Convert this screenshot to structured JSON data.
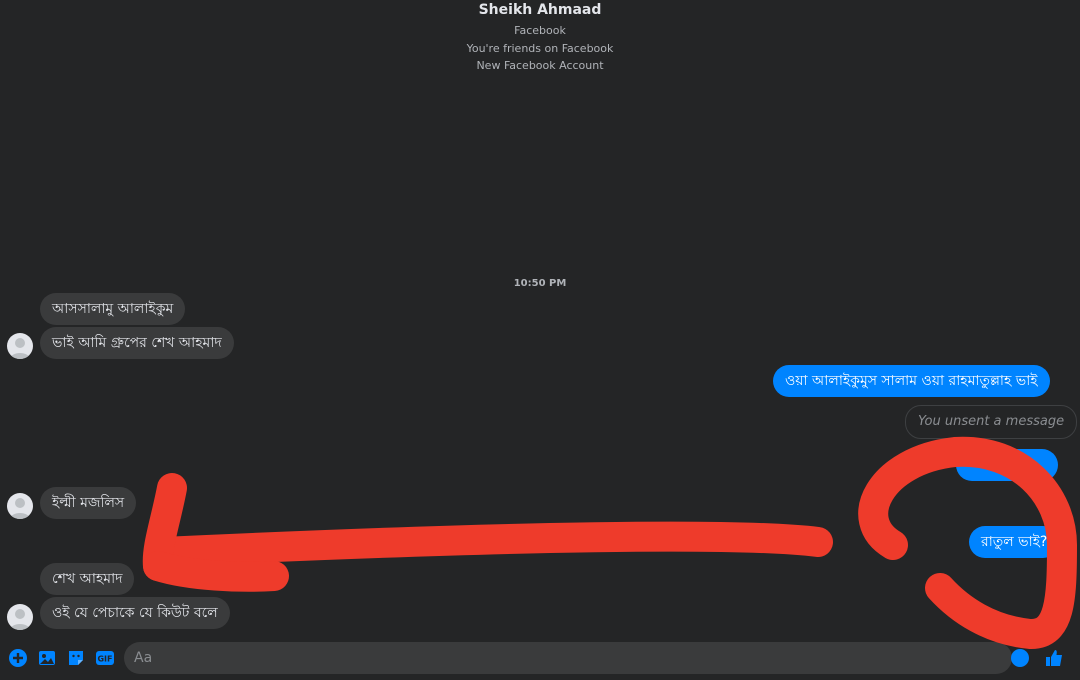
{
  "header": {
    "name": "Sheikh Ahmaad",
    "platform": "Facebook",
    "friend_status": "You're friends on Facebook",
    "account_note": "New Facebook Account"
  },
  "timestamp": "10:50 PM",
  "messages": [
    {
      "dir": "in",
      "text": "আসসালামু আলাইকুম"
    },
    {
      "dir": "in",
      "text": "ভাই আমি গ্রুপের শেখ আহমাদ"
    },
    {
      "dir": "out",
      "text": "ওয়া আলাইকুমুস সালাম ওয়া রাহমাতুল্লাহ ভাই"
    },
    {
      "dir": "out-unsent",
      "text": "You unsent a message"
    },
    {
      "dir": "in",
      "text": "ইল্মী মজলিস"
    },
    {
      "dir": "out",
      "text": "রাতুল ভাই?"
    },
    {
      "dir": "in",
      "text": "শেখ আহমাদ"
    },
    {
      "dir": "in",
      "text": "ওই যে পেচাকে যে কিউট বলে"
    }
  ],
  "composer": {
    "placeholder": "Aa",
    "tools": [
      "plus-icon",
      "photo-icon",
      "sticker-icon",
      "gif-icon"
    ],
    "gif_label": "GIF"
  },
  "colors": {
    "background": "#242526",
    "incoming_bubble": "#3a3b3c",
    "outgoing_bubble": "#0084ff",
    "annotation_red": "#ee3b2b"
  }
}
